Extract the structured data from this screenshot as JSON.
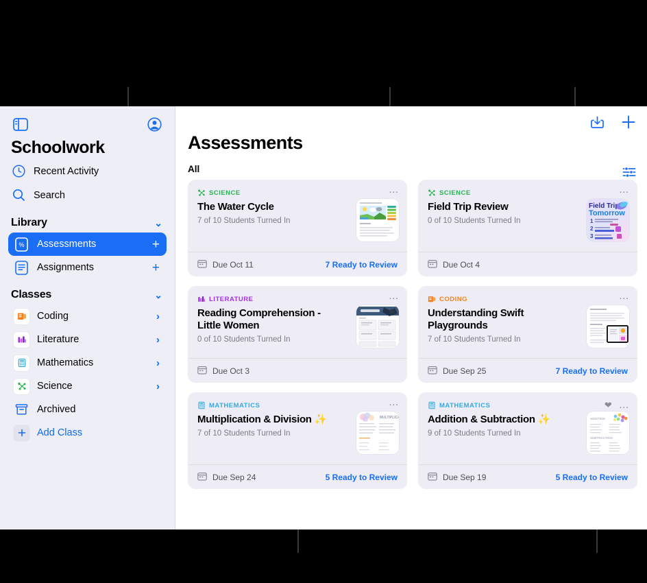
{
  "sidebar": {
    "app_title": "Schoolwork",
    "toggle_icon": "sidebar-toggle-icon",
    "account_icon": "account-circle-icon",
    "quick_links": [
      {
        "label": "Recent Activity",
        "icon": "clock-icon"
      },
      {
        "label": "Search",
        "icon": "search-icon"
      }
    ],
    "library": {
      "header": "Library",
      "items": [
        {
          "label": "Assessments",
          "icon": "assessments-icon",
          "trailing": "+",
          "selected": true
        },
        {
          "label": "Assignments",
          "icon": "assignments-icon",
          "trailing": "+",
          "selected": false
        }
      ]
    },
    "classes": {
      "header": "Classes",
      "items": [
        {
          "label": "Coding",
          "icon": "coding-app-icon",
          "trailing": "›"
        },
        {
          "label": "Literature",
          "icon": "literature-app-icon",
          "trailing": "›"
        },
        {
          "label": "Mathematics",
          "icon": "mathematics-app-icon",
          "trailing": "›"
        },
        {
          "label": "Science",
          "icon": "science-app-icon",
          "trailing": "›"
        }
      ],
      "archived": {
        "label": "Archived",
        "icon": "archive-box-icon"
      },
      "add_class": {
        "label": "Add Class",
        "icon": "plus-icon"
      }
    }
  },
  "main": {
    "title": "Assessments",
    "subtitle": "All",
    "toolbar": {
      "share_icon": "share-download-icon",
      "add_icon": "plus-icon",
      "filter_icon": "filter-sliders-icon"
    },
    "cards": [
      {
        "category": "SCIENCE",
        "category_color": "#27b451",
        "category_icon": "science-molecule-icon",
        "title": "The Water Cycle",
        "status": "7 of 10 Students Turned In",
        "due": "Due Oct 11",
        "ready": "7 Ready to Review",
        "favorited": false,
        "thumb": "water-cycle-worksheet"
      },
      {
        "category": "SCIENCE",
        "category_color": "#27b451",
        "category_icon": "science-molecule-icon",
        "title": "Field Trip Review",
        "status": "0 of 10 Students Turned In",
        "due": "Due Oct 4",
        "ready": "",
        "favorited": false,
        "thumb": "field-trip-poster"
      },
      {
        "category": "LITERATURE",
        "category_color": "#a52fe0",
        "category_icon": "literature-books-icon",
        "title": "Reading Comprehension - Little Women",
        "status": "0 of 10 Students Turned In",
        "due": "Due Oct 3",
        "ready": "",
        "favorited": false,
        "thumb": "reading-comprehension-doc"
      },
      {
        "category": "CODING",
        "category_color": "#f58220",
        "category_icon": "coding-book-icon",
        "title": "Understanding Swift Playgrounds",
        "status": "7 of 10 Students Turned In",
        "due": "Due Sep 25",
        "ready": "7 Ready to Review",
        "favorited": false,
        "thumb": "swift-playgrounds-doc"
      },
      {
        "category": "MATHEMATICS",
        "category_color": "#2eabe8",
        "category_icon": "calculator-icon",
        "title": "Multiplication & Division ✨",
        "status": "7 of 10 Students Turned In",
        "due": "Due Sep 24",
        "ready": "5 Ready to Review",
        "favorited": false,
        "thumb": "multiplication-worksheet"
      },
      {
        "category": "MATHEMATICS",
        "category_color": "#2eabe8",
        "category_icon": "calculator-icon",
        "title": "Addition & Subtraction ✨",
        "status": "9 of 10 Students Turned In",
        "due": "Due Sep 19",
        "ready": "5 Ready to Review",
        "favorited": true,
        "thumb": "addition-worksheet"
      }
    ]
  },
  "colors": {
    "accent_blue": "#1a6ef5",
    "sidebar_bg": "#eeeef7",
    "card_bg": "#eeedf6",
    "page_bg": "#ffffff",
    "backdrop": "#000000"
  }
}
